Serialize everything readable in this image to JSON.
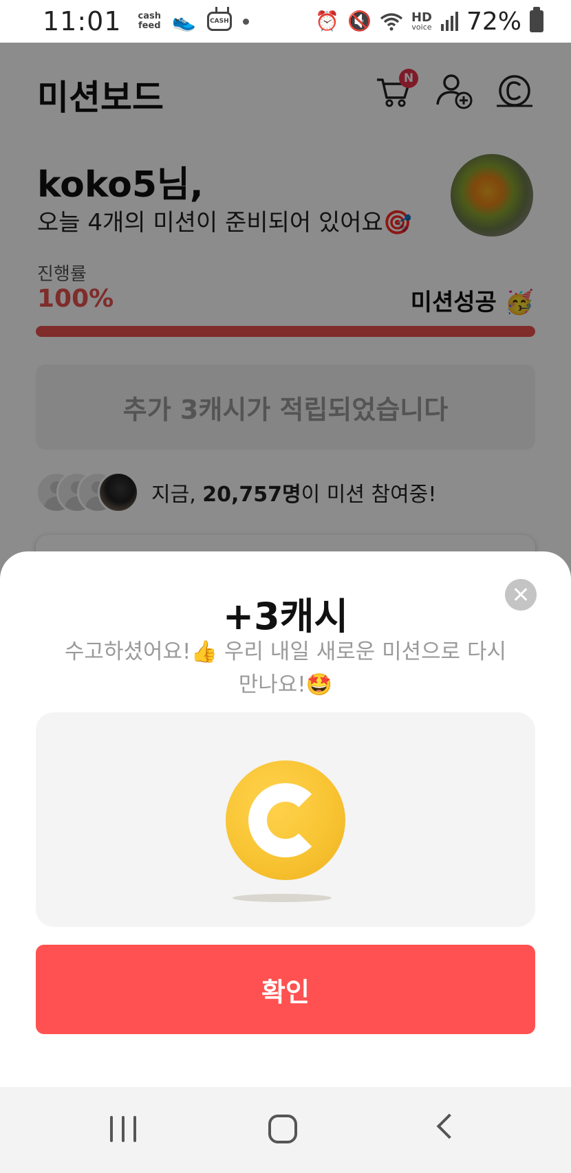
{
  "status_bar": {
    "time": "11:01",
    "cashfeed_line1": "cash",
    "cashfeed_line2": "feed",
    "cash_tv_label": "CASH",
    "hd_label": "HD",
    "voice_label": "voice",
    "battery": "72%"
  },
  "header": {
    "title": "미션보드",
    "cart_badge": "N",
    "icons": [
      "cart-icon",
      "add-friend-icon",
      "cash-icon"
    ]
  },
  "greeting": {
    "name": "koko5님,",
    "message": "오늘 4개의 미션이 준비되어 있어요🎯"
  },
  "progress": {
    "label": "진행률",
    "value_text": "100%",
    "fraction": 1.0,
    "status": "미션성공 🥳"
  },
  "reward_banner": "추가 3캐시가 적립되었습니다",
  "participants": {
    "prefix": "지금, ",
    "count": "20,757명",
    "suffix": "이 미션 참여중!"
  },
  "sheet": {
    "title": "+3캐시",
    "message": "수고하셨어요!👍 우리 내일 새로운 미션으로 다시 만나요!🤩",
    "confirm_label": "확인"
  },
  "colors": {
    "accent_red": "#ff5151",
    "progress_red": "#e8504f",
    "coin_yellow": "#f8c433"
  }
}
